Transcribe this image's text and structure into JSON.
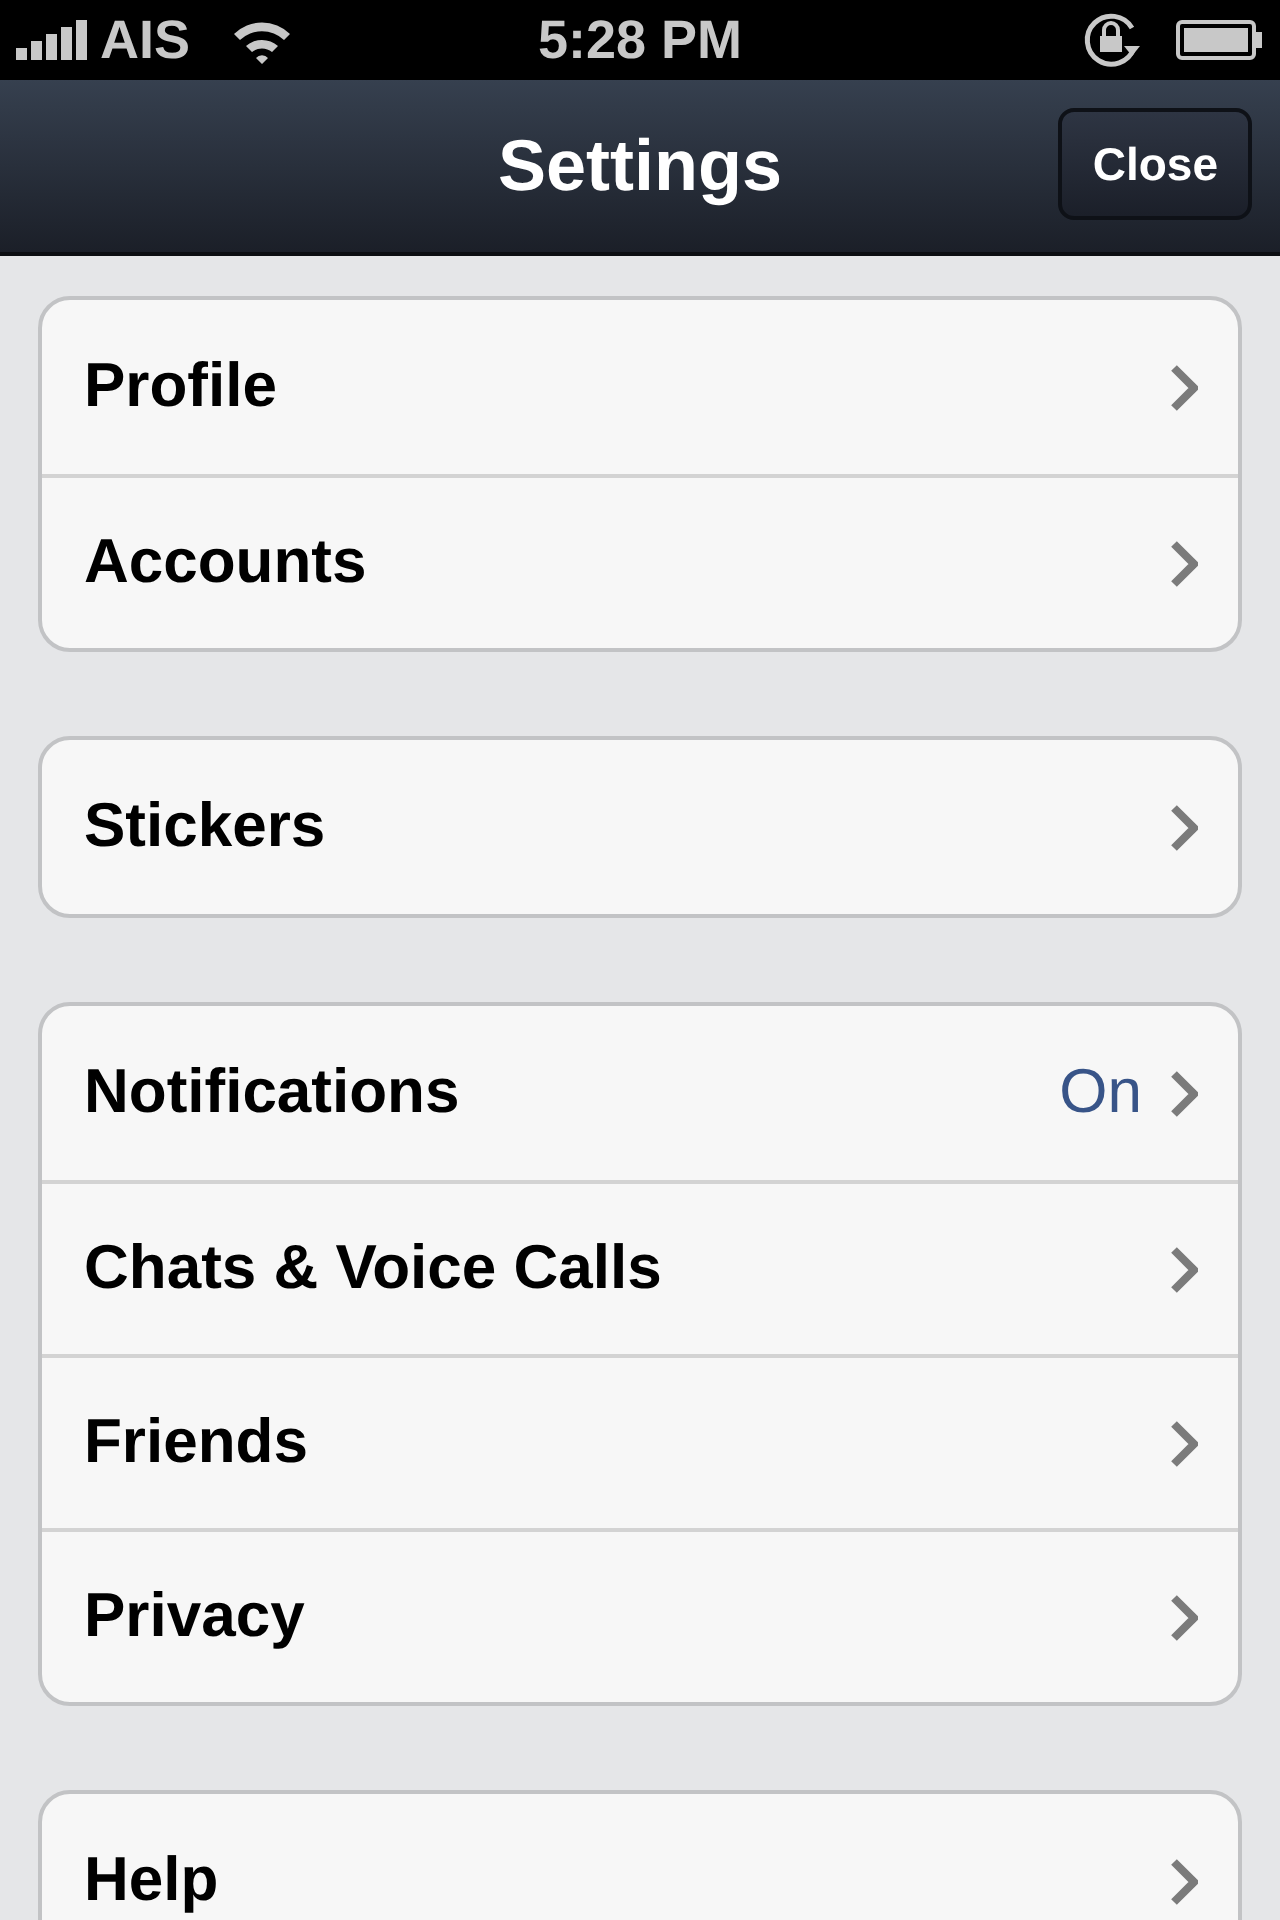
{
  "status_bar": {
    "carrier": "AIS",
    "time": "5:28 PM"
  },
  "nav_bar": {
    "title": "Settings",
    "button": "Close"
  },
  "groups": [
    {
      "rows": [
        {
          "label": "Profile"
        },
        {
          "label": "Accounts"
        }
      ]
    },
    {
      "rows": [
        {
          "label": "Stickers"
        }
      ]
    },
    {
      "rows": [
        {
          "label": "Notifications",
          "value": "On"
        },
        {
          "label": "Chats & Voice Calls"
        },
        {
          "label": "Friends"
        },
        {
          "label": "Privacy"
        }
      ]
    },
    {
      "rows": [
        {
          "label": "Help"
        }
      ]
    }
  ]
}
